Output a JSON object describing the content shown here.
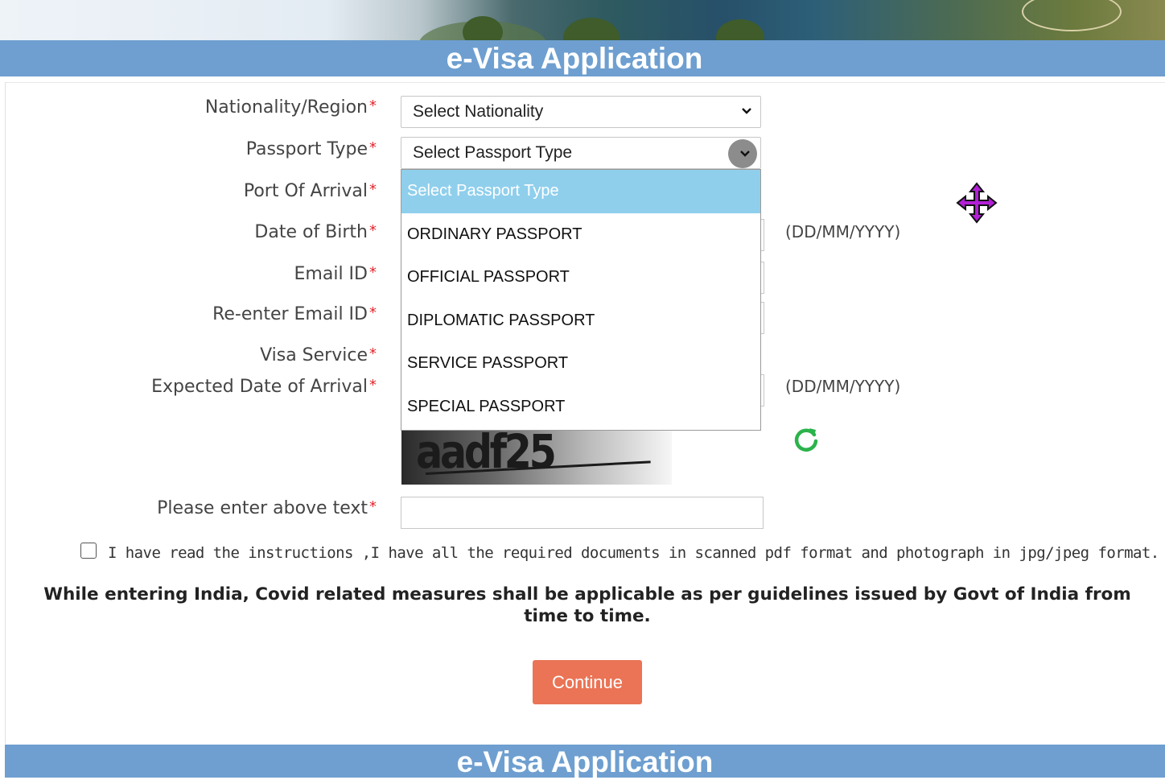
{
  "header": {
    "title": "e-Visa Application"
  },
  "form": {
    "nationality": {
      "label": "Nationality/Region",
      "required_mark": "*",
      "selected": "Select Nationality"
    },
    "passport_type": {
      "label": "Passport Type",
      "required_mark": "*",
      "selected": "Select Passport Type",
      "options": [
        "Select Passport Type",
        "ORDINARY PASSPORT",
        "OFFICIAL PASSPORT",
        "DIPLOMATIC PASSPORT",
        "SERVICE PASSPORT",
        "SPECIAL PASSPORT"
      ]
    },
    "port_of_arrival": {
      "label": "Port Of Arrival",
      "required_mark": "*"
    },
    "date_of_birth": {
      "label": "Date of Birth",
      "required_mark": "*",
      "hint": "(DD/MM/YYYY)"
    },
    "email": {
      "label": "Email ID",
      "required_mark": "*"
    },
    "reenter_email": {
      "label": "Re-enter Email ID",
      "required_mark": "*"
    },
    "visa_service": {
      "label": "Visa Service",
      "required_mark": "*"
    },
    "expected_arrival": {
      "label": "Expected Date of Arrival",
      "required_mark": "*",
      "hint": "(DD/MM/YYYY)"
    },
    "captcha": {
      "text": "aadf25"
    },
    "captcha_input": {
      "label": "Please enter above text",
      "required_mark": "*",
      "value": ""
    },
    "declaration": "I have read the instructions ,I have all the required documents in scanned pdf format and photograph in jpg/jpeg format.",
    "notice": "While entering India, Covid related measures shall be applicable as per guidelines issued by Govt of India from time to time.",
    "continue_label": "Continue"
  },
  "footer": {
    "title": "e-Visa Application"
  },
  "colors": {
    "title_bar": "#6e9fd0",
    "required": "#e2252c",
    "continue": "#ea7455",
    "selected_option": "#8fcfec",
    "refresh_icon": "#2bb34b",
    "move_cursor": "#b21fd6"
  },
  "icons": {
    "dropdown": "chevron-down-icon",
    "refresh": "refresh-icon",
    "cursor": "move-cursor-icon"
  }
}
